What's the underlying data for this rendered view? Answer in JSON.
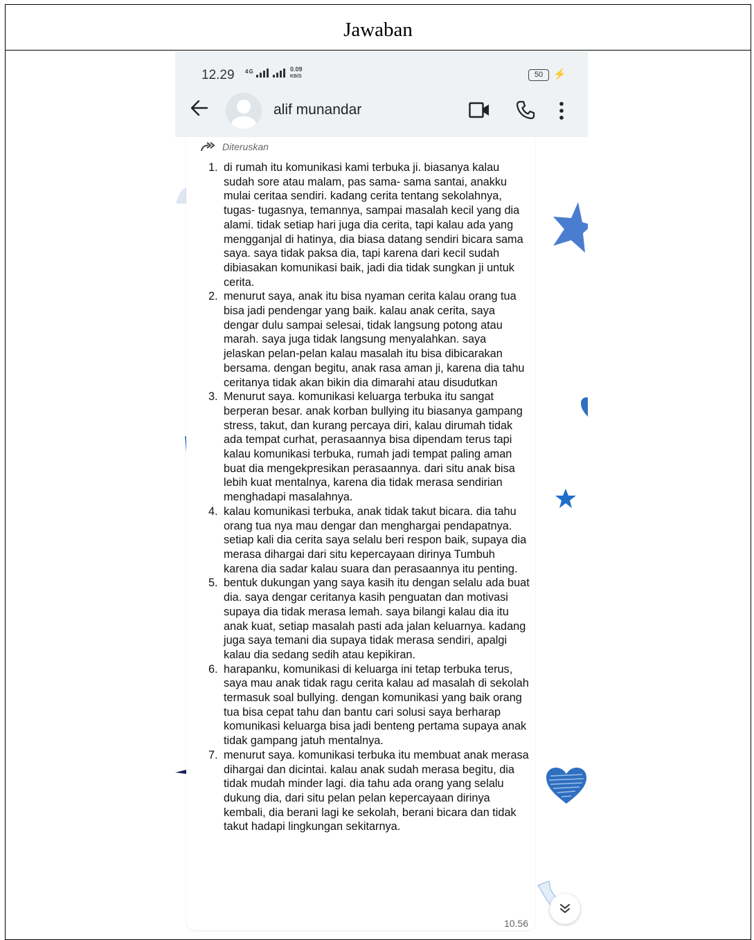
{
  "document": {
    "header": "Jawaban"
  },
  "status_bar": {
    "time": "12.29",
    "network": "4G",
    "speed_value": "0.09",
    "speed_unit": "KB/S",
    "battery": "50"
  },
  "chat_header": {
    "contact_name": "alif munandar"
  },
  "message": {
    "forwarded_label": "Diteruskan",
    "timestamp": "10.56",
    "items": [
      {
        "num": "1.",
        "text": "di rumah itu komunikasi kami terbuka ji. biasanya kalau sudah sore atau malam, pas sama- sama santai, anakku mulai ceritaa sendiri. kadang cerita tentang sekolahnya, tugas- tugasnya, temannya, sampai masalah kecil yang dia alami. tidak setiap hari juga dia cerita, tapi kalau ada yang mengganjal di hatinya, dia biasa datang sendiri bicara sama saya. saya tidak paksa dia, tapi karena dari kecil sudah dibiasakan komunikasi baik, jadi dia tidak sungkan ji untuk cerita."
      },
      {
        "num": "2.",
        "text": "menurut saya, anak itu bisa nyaman cerita kalau orang tua bisa jadi pendengar yang baik. kalau anak cerita, saya dengar dulu sampai selesai, tidak langsung potong atau marah. saya juga tidak langsung menyalahkan. saya jelaskan pelan-pelan kalau masalah itu bisa dibicarakan bersama. dengan begitu, anak rasa aman ji, karena dia tahu ceritanya tidak akan bikin dia dimarahi atau disudutkan"
      },
      {
        "num": "3.",
        "text": "Menurut saya. komunikasi keluarga terbuka itu sangat berperan besar. anak korban bullying itu biasanya gampang stress, takut, dan kurang percaya diri, kalau dirumah tidak ada tempat curhat, perasaannya bisa dipendam terus tapi kalau komunikasi terbuka, rumah jadi tempat paling aman buat dia mengekpresikan perasaannya. dari situ anak bisa lebih kuat mentalnya, karena dia tidak merasa sendirian menghadapi masalahnya."
      },
      {
        "num": "4.",
        "text": "kalau komunikasi terbuka, anak tidak takut bicara. dia tahu orang tua nya mau dengar dan menghargai pendapatnya. setiap kali dia cerita saya selalu beri respon baik, supaya dia merasa dihargai dari situ kepercayaan dirinya Tumbuh karena dia sadar kalau suara dan perasaannya itu penting."
      },
      {
        "num": "5.",
        "text": "bentuk dukungan yang saya kasih itu dengan selalu ada buat dia. saya dengar ceritanya kasih penguatan dan motivasi supaya dia tidak merasa lemah. saya bilangi kalau dia itu anak kuat, setiap masalah pasti ada jalan keluarnya. kadang juga saya temani dia supaya tidak merasa sendiri, apalgi kalau dia sedang sedih atau kepikiran."
      },
      {
        "num": "6.",
        "text": "harapanku, komunikasi di keluarga ini tetap terbuka terus, saya mau anak tidak ragu cerita kalau ad masalah di sekolah termasuk soal bullying. dengan komunikasi yang baik orang tua bisa cepat tahu dan bantu cari solusi saya berharap komunikasi keluarga bisa jadi benteng pertama supaya anak tidak gampang jatuh mentalnya."
      },
      {
        "num": "7.",
        "text": "menurut saya. komunikasi terbuka itu membuat anak merasa dihargai dan dicintai. kalau anak sudah merasa begitu, dia tidak mudah minder lagi. dia tahu ada orang yang selalu dukung dia, dari situ pelan pelan kepercayaan dirinya kembali, dia berani lagi ke sekolah, berani bicara dan tidak takut hadapi lingkungan sekitarnya."
      }
    ]
  },
  "icons": [
    "back-arrow-icon",
    "avatar-icon",
    "video-call-icon",
    "phone-call-icon",
    "more-vert-icon",
    "forward-icon",
    "scroll-down-icon"
  ],
  "colors": {
    "header_bg": "#eef2f4",
    "wallpaper_accent": "#4a7cd0"
  }
}
